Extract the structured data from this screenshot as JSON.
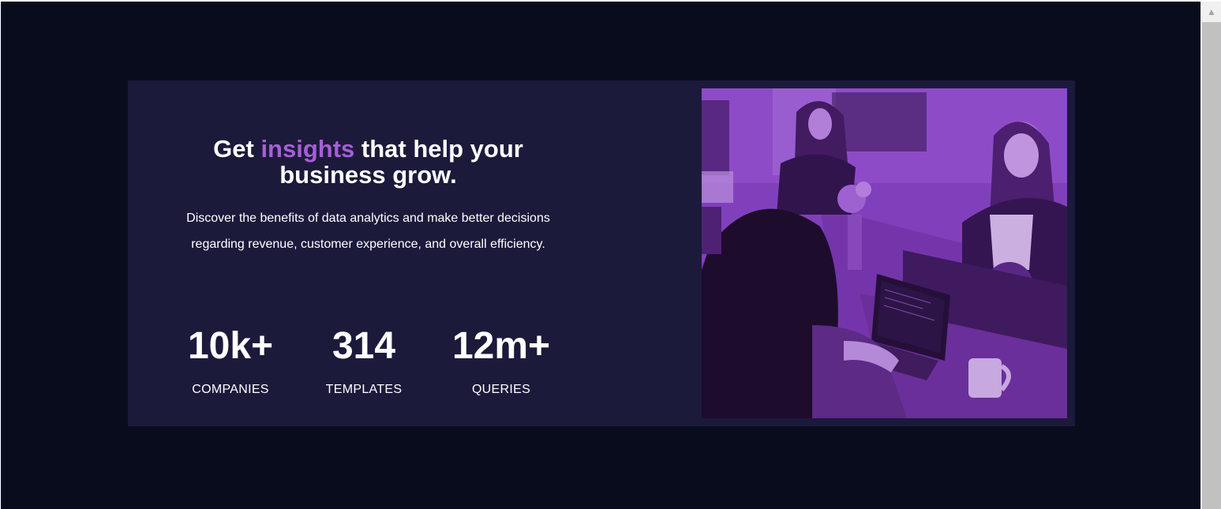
{
  "hero": {
    "headline_before": "Get ",
    "headline_accent": "insights",
    "headline_after": " that help your business grow.",
    "description": "Discover the benefits of data analytics and make better decisions regarding revenue, customer experience, and overall efficiency.",
    "accent_color": "#a65fd6",
    "card_color": "#1c1a3b",
    "page_background": "#090c1d"
  },
  "stats": [
    {
      "value": "10k+",
      "label": "COMPANIES"
    },
    {
      "value": "314",
      "label": "TEMPLATES"
    },
    {
      "value": "12m+",
      "label": "QUERIES"
    }
  ],
  "image": {
    "subject": "people working at a table with laptops, purple overlay",
    "overlay_color": "#8b46c9"
  },
  "scrollbar": {
    "up_icon": "triangle-up-icon"
  }
}
